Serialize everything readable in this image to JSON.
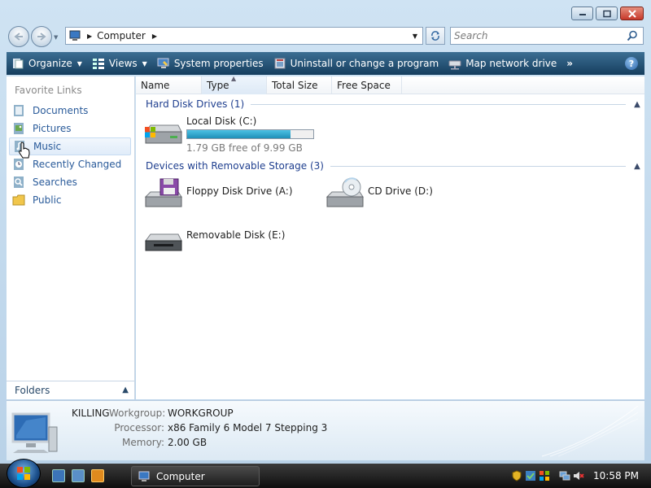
{
  "window": {
    "title": "Computer"
  },
  "address": {
    "location": "Computer"
  },
  "search": {
    "placeholder": "Search"
  },
  "toolbar": {
    "organize": "Organize",
    "views": "Views",
    "system_properties": "System properties",
    "uninstall": "Uninstall or change a program",
    "map_drive": "Map network drive",
    "more": "»",
    "help": "?"
  },
  "sidebar": {
    "title": "Favorite Links",
    "items": [
      {
        "label": "Documents",
        "icon": "documents-icon"
      },
      {
        "label": "Pictures",
        "icon": "pictures-icon"
      },
      {
        "label": "Music",
        "icon": "music-icon"
      },
      {
        "label": "Recently Changed",
        "icon": "recently-changed-icon"
      },
      {
        "label": "Searches",
        "icon": "searches-icon"
      },
      {
        "label": "Public",
        "icon": "public-folder-icon"
      }
    ],
    "folders_label": "Folders"
  },
  "columns": [
    "Name",
    "Type",
    "Total Size",
    "Free Space"
  ],
  "groups": {
    "hdd": "Hard Disk Drives (1)",
    "removable": "Devices with Removable Storage (3)"
  },
  "drives": {
    "local": {
      "name": "Local Disk (C:)",
      "free_text": "1.79 GB free of 9.99 GB",
      "used_fraction": 0.82
    },
    "floppy": {
      "name": "Floppy Disk Drive (A:)"
    },
    "cd": {
      "name": "CD Drive (D:)"
    },
    "removable": {
      "name": "Removable Disk (E:)"
    }
  },
  "details": {
    "computer_name": "KILLING",
    "workgroup_label": "Workgroup:",
    "workgroup": "WORKGROUP",
    "processor_label": "Processor:",
    "processor": "x86 Family 6 Model 7 Stepping 3",
    "memory_label": "Memory:",
    "memory": "2.00 GB"
  },
  "taskbar": {
    "task_label": "Computer",
    "clock": "10:58 PM"
  },
  "colors": {
    "link": "#2a5b9a",
    "group": "#1f3f8f",
    "commandbar": "#1f4b70",
    "bar_fill": "#1f8fb8"
  }
}
